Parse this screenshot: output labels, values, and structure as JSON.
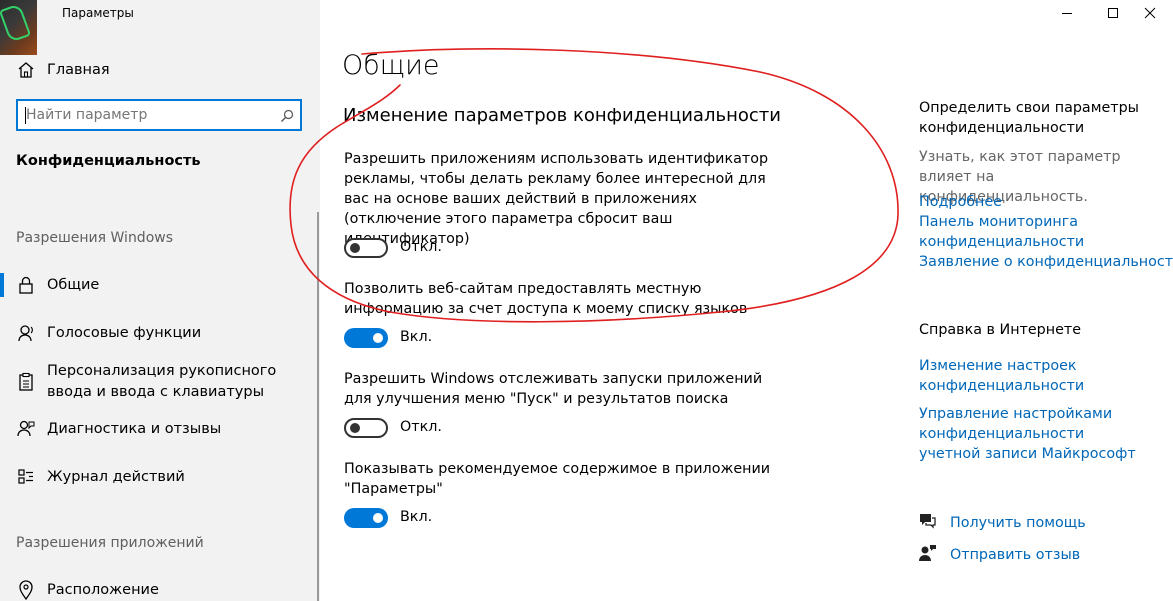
{
  "window": {
    "title": "Параметры",
    "minimize_icon": "minimize-icon",
    "maximize_icon": "maximize-icon",
    "close_icon": "close-icon"
  },
  "sidebar": {
    "home_label": "Главная",
    "home_icon": "home-icon",
    "search": {
      "placeholder": "Найти параметр",
      "icon": "search-icon"
    },
    "section_title": "Конфиденциальность",
    "windows_group": {
      "header": "Разрешения Windows",
      "items": [
        {
          "label": "Общие",
          "icon": "lock-icon",
          "selected": true
        },
        {
          "label": "Голосовые функции",
          "icon": "voice-icon"
        },
        {
          "label": "Персонализация рукописного ввода и ввода с клавиатуры",
          "icon": "clipboard-icon"
        },
        {
          "label": "Диагностика и отзывы",
          "icon": "feedback-icon"
        },
        {
          "label": "Журнал действий",
          "icon": "activity-icon"
        }
      ]
    },
    "apps_group": {
      "header": "Разрешения приложений",
      "items": [
        {
          "label": "Расположение",
          "icon": "location-icon"
        }
      ]
    }
  },
  "main": {
    "title": "Общие",
    "subtitle": "Изменение параметров конфиденциальности",
    "settings": [
      {
        "description": "Разрешить приложениям использовать идентификатор рекламы, чтобы делать рекламу более интересной для вас на основе ваших действий в приложениях (отключение этого параметра сбросит ваш идентификатор)",
        "state": "Откл.",
        "on": false
      },
      {
        "description": "Позволить веб-сайтам предоставлять местную информацию за счет доступа к моему списку языков",
        "state": "Вкл.",
        "on": true
      },
      {
        "description": "Разрешить Windows отслеживать запуски приложений для улучшения меню \"Пуск\" и результатов поиска",
        "state": "Откл.",
        "on": false
      },
      {
        "description": "Показывать рекомендуемое содержимое в приложении \"Параметры\"",
        "state": "Вкл.",
        "on": true
      }
    ]
  },
  "right_panel": {
    "choose_heading": "Определить свои параметры конфиденциальности",
    "choose_text": "Узнать, как этот параметр влияет на конфиденциальность.",
    "links": [
      "Подробнее",
      "Панель мониторинга конфиденциальности",
      "Заявление о конфиденциальности"
    ],
    "help_heading": "Справка в Интернете",
    "help_links": [
      "Изменение настроек конфиденциальности",
      "Управление настройками конфиденциальности учетной записи Майкрософт"
    ],
    "get_help": {
      "label": "Получить помощь",
      "icon": "help-chat-icon"
    },
    "send_feedback": {
      "label": "Отправить отзыв",
      "icon": "feedback-person-icon"
    }
  },
  "colors": {
    "accent": "#0078d7",
    "link": "#0067b8",
    "annotation": "#e02020"
  }
}
